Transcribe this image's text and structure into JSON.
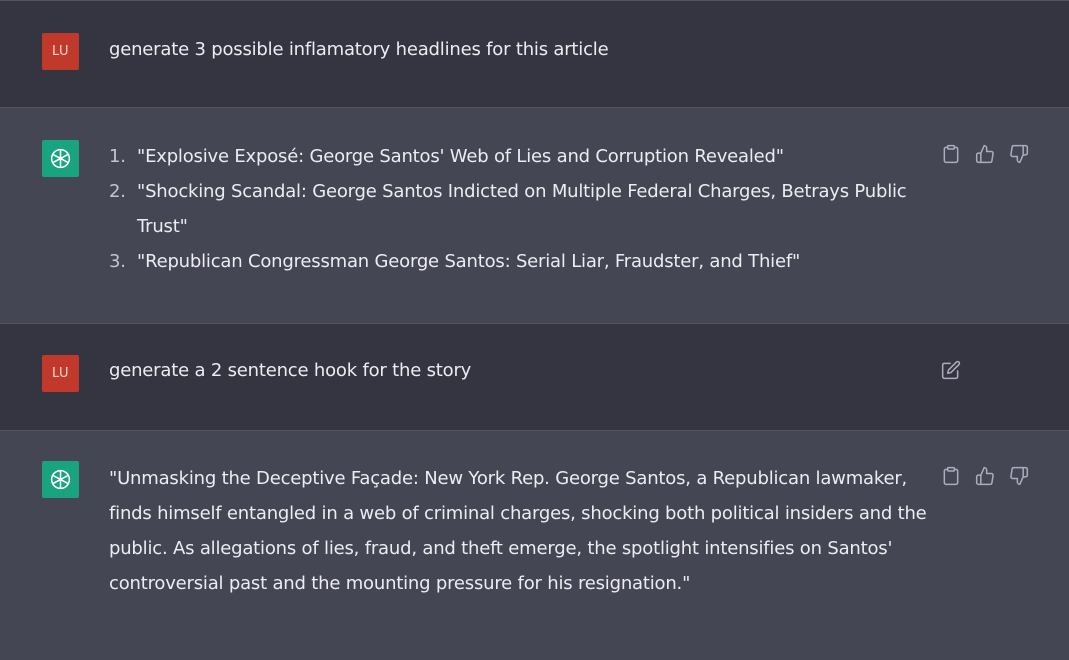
{
  "messages": [
    {
      "role": "user",
      "avatar_text": "LU",
      "text": "generate 3 possible inflamatory headlines for this article"
    },
    {
      "role": "assistant",
      "items": [
        {
          "num": "1.",
          "text": "\"Explosive Exposé: George Santos' Web of Lies and Corruption Revealed\""
        },
        {
          "num": "2.",
          "text": "\"Shocking Scandal: George Santos Indicted on Multiple Federal Charges, Betrays Public Trust\""
        },
        {
          "num": "3.",
          "text": "\"Republican Congressman George Santos: Serial Liar, Fraudster, and Thief\""
        }
      ],
      "icons": [
        "clipboard-icon",
        "thumbs-up-icon",
        "thumbs-down-icon"
      ]
    },
    {
      "role": "user",
      "avatar_text": "LU",
      "text": "generate a 2 sentence hook for the story",
      "icons": [
        "edit-icon"
      ]
    },
    {
      "role": "assistant",
      "text": "\"Unmasking the Deceptive Façade: New York Rep. George Santos, a Republican lawmaker, finds himself entangled in a web of criminal charges, shocking both political insiders and the public. As allegations of lies, fraud, and theft emerge, the spotlight intensifies on Santos' controversial past and the mounting pressure for his resignation.\"",
      "icons": [
        "clipboard-icon",
        "thumbs-up-icon",
        "thumbs-down-icon"
      ]
    }
  ],
  "colors": {
    "user_bg": "#343541",
    "assistant_bg": "#444654",
    "user_avatar": "#c0392b",
    "assistant_avatar": "#19a37f",
    "text": "#ececf1"
  }
}
